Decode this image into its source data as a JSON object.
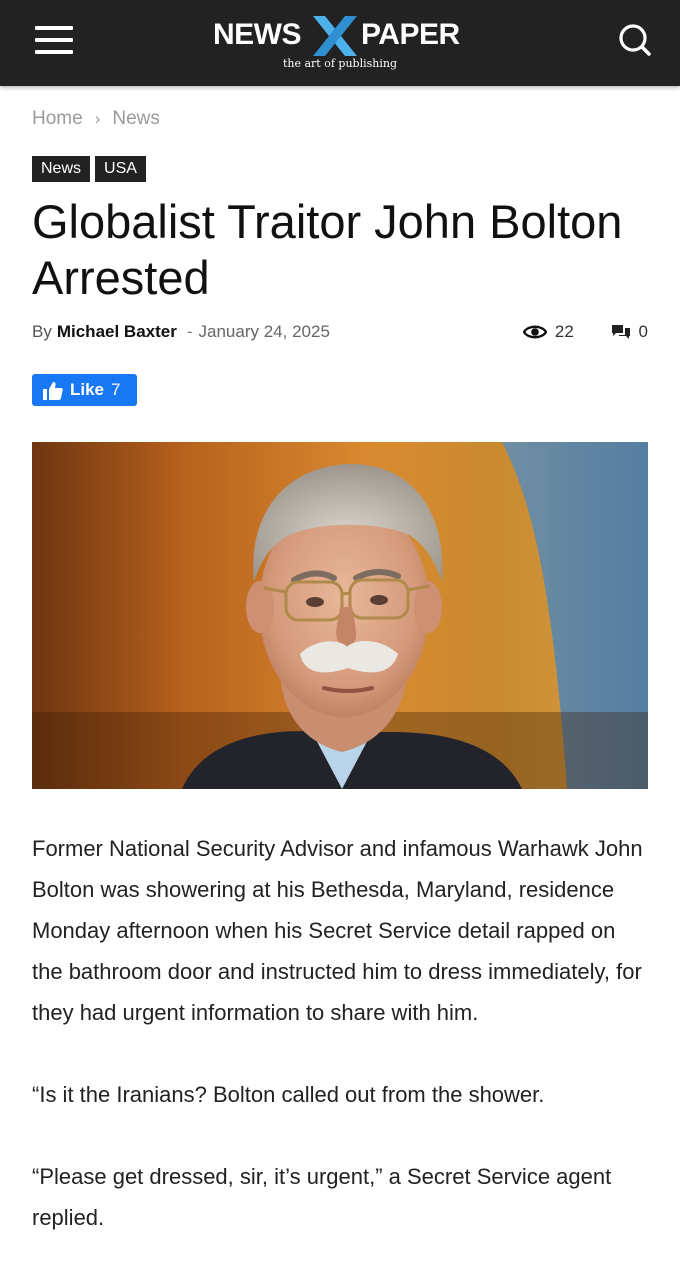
{
  "header": {
    "logo_left": "NEWS",
    "logo_right": "PAPER",
    "tagline": "the art of publishing",
    "icons": [
      "hamburger-menu-icon",
      "search-icon"
    ],
    "accent": "#4db2ec",
    "background": "#222222"
  },
  "breadcrumb": {
    "items": [
      "Home",
      "News"
    ],
    "separator": "›"
  },
  "categories": [
    "News",
    "USA"
  ],
  "article": {
    "title": "Globalist Traitor John Bolton Arrested",
    "by_label": "By",
    "author": "Michael Baxter",
    "date": "January 24, 2025",
    "views": "22",
    "comments": "0",
    "like_label": "Like",
    "like_count": "7",
    "paragraphs": [
      "Former National Security Advisor and infamous Warhawk John Bolton was showering at his Bethesda, Maryland, residence Monday afternoon when his Secret Service detail rapped on the bathroom door and instructed him to dress immediately, for they had urgent information to share with him.",
      "“Is it the Iranians? Bolton called out from the shower.",
      "“Please get dressed, sir, it’s urgent,” a Secret Service agent replied."
    ]
  },
  "colors": {
    "facebook_blue": "#1877f2",
    "category_bg": "#222222"
  }
}
